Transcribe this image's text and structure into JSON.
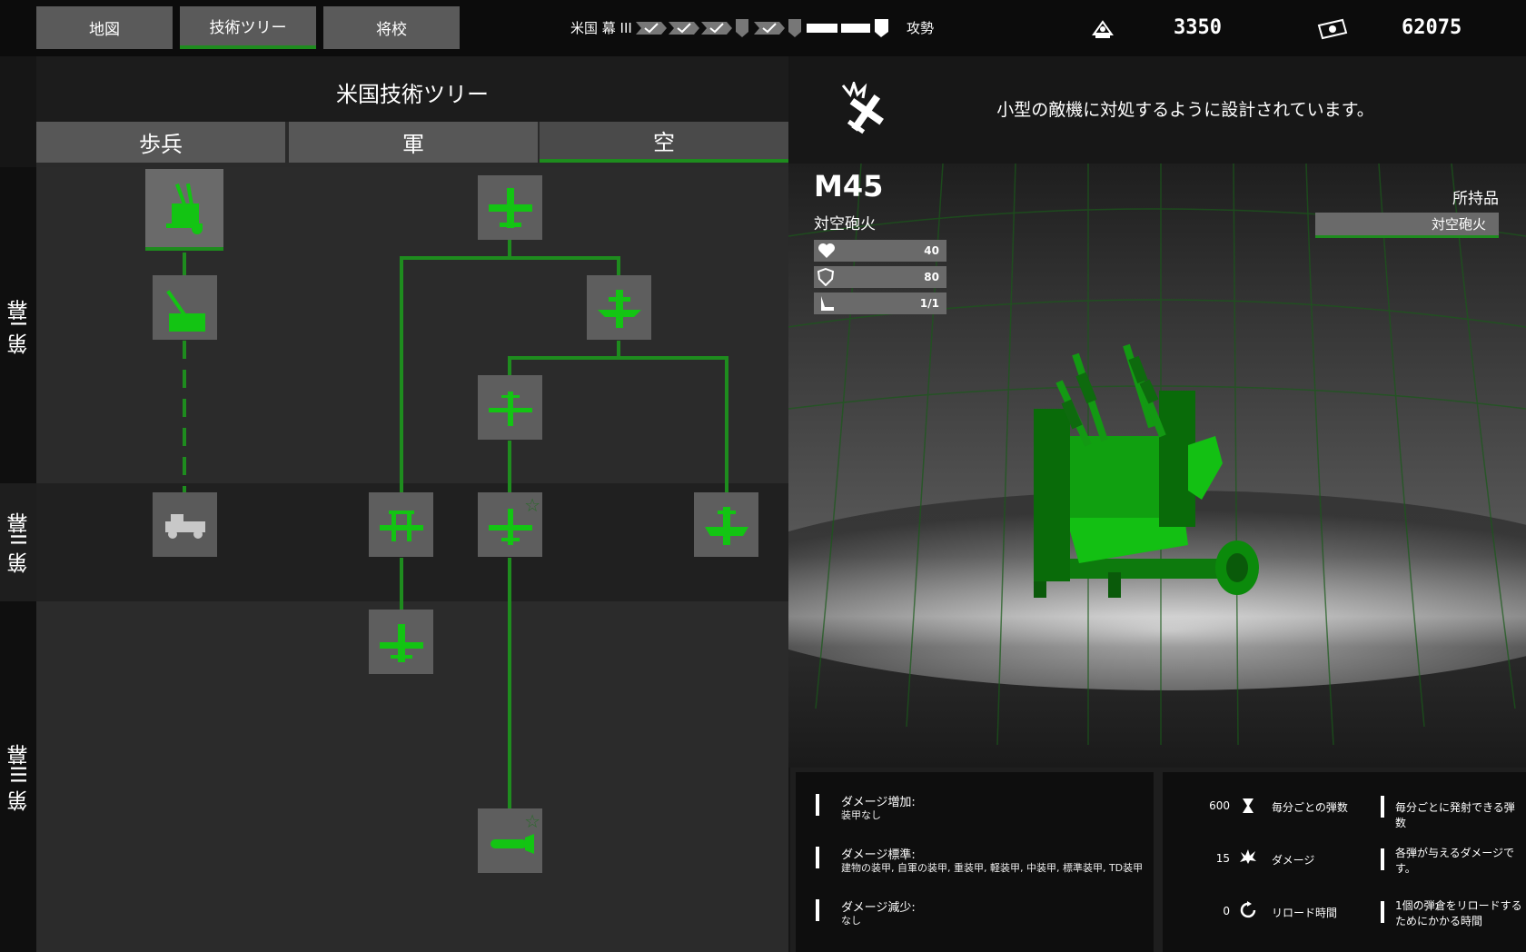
{
  "nav": {
    "tabs": [
      {
        "label": "地図"
      },
      {
        "label": "技術ツリー",
        "active": true
      },
      {
        "label": "将校"
      }
    ]
  },
  "progress": {
    "faction_label": "米国 幕 III",
    "offensive_label": "攻勢"
  },
  "resources": {
    "resource_a": {
      "icon": "ammo-crate-icon",
      "value": "3350"
    },
    "resource_b": {
      "icon": "money-icon",
      "value": "62075"
    }
  },
  "tree": {
    "title": "米国技術ツリー",
    "categories": [
      {
        "label": "歩兵"
      },
      {
        "label": "軍"
      },
      {
        "label": "空",
        "active": true
      }
    ],
    "eras": [
      "第 I幕",
      "第 II幕",
      "第 III幕"
    ]
  },
  "detail": {
    "description": "小型の敵機に対処するように設計されています。",
    "unit_name": "M45",
    "unit_type": "対空砲火",
    "stats": [
      {
        "icon": "heart-icon",
        "value": "40"
      },
      {
        "icon": "shield-icon",
        "value": "80"
      },
      {
        "icon": "seat-icon",
        "value": "1/1"
      }
    ],
    "inventory_label": "所持品",
    "inventory_item": "対空砲火"
  },
  "damage_info": [
    {
      "title": "ダメージ増加:",
      "value": "装甲なし"
    },
    {
      "title": "ダメージ標準:",
      "value": "建物の装甲, 自軍の装甲, 重装甲, 軽装甲, 中装甲, 標準装甲, TD装甲"
    },
    {
      "title": "ダメージ減少:",
      "value": "なし"
    }
  ],
  "weapon_stats": [
    {
      "value": "600",
      "icon": "hourglass-icon",
      "label": "毎分ごとの弾数",
      "desc": "毎分ごとに発射できる弾数"
    },
    {
      "value": "15",
      "icon": "explosion-icon",
      "label": "ダメージ",
      "desc": "各弾が与えるダメージです。"
    },
    {
      "value": "0",
      "icon": "reload-icon",
      "label": "リロード時間",
      "desc": "1個の弾倉をリロードするためにかかる時間"
    }
  ],
  "colors": {
    "accent": "#1e8c1e",
    "unit_green": "#13d413"
  }
}
